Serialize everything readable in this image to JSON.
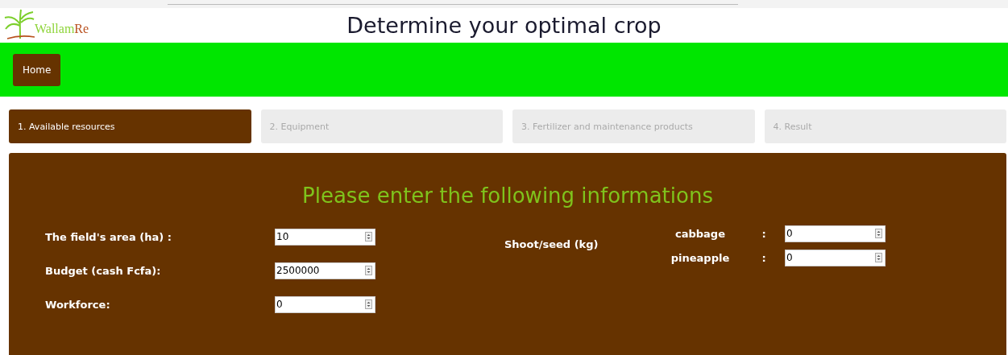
{
  "header": {
    "logo_parts": [
      "Wallam",
      "Re"
    ],
    "title": "Determine your optimal crop"
  },
  "nav": {
    "items": [
      {
        "label": "Home",
        "selected": true
      }
    ]
  },
  "steps": [
    {
      "label": "1. Available resources",
      "selected": true
    },
    {
      "label": "2. Equipment",
      "selected": false
    },
    {
      "label": "3. Fertilizer and maintenance products",
      "selected": false
    },
    {
      "label": "4. Result",
      "selected": false
    }
  ],
  "form": {
    "heading": "Please enter the following informations",
    "fields": [
      {
        "label": "The field's area (ha) :",
        "value": "10"
      },
      {
        "label": "Budget (cash Fcfa):",
        "value": "2500000"
      },
      {
        "label": "Workforce:",
        "value": "0"
      }
    ],
    "seed": {
      "label": "Shoot/seed (kg)",
      "items": [
        {
          "label": "cabbage",
          "colon": ":",
          "value": "0"
        },
        {
          "label": "pineapple",
          "colon": ":",
          "value": "0"
        }
      ]
    }
  }
}
